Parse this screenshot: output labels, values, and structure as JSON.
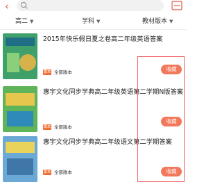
{
  "header": {
    "back_icon": "back-icon",
    "search_icon": "search-icon",
    "scan_icon": "scan-icon"
  },
  "filters": [
    {
      "label": "高二"
    },
    {
      "label": "学科"
    },
    {
      "label": "教材版本"
    }
  ],
  "results": [
    {
      "title": "2015年快乐假日夏之卷高二年级英语答案",
      "badge": "版本",
      "edition": "全部版本",
      "collect": "收藏"
    },
    {
      "title": "惠宇文化同步学典高二年级英语第二学期N版答案",
      "badge": "版本",
      "edition": "全部版本",
      "collect": "收藏"
    },
    {
      "title": "惠宇文化同步学典高二年级语文第二学期答案",
      "badge": "版本",
      "edition": "全部版本",
      "collect": "收藏"
    }
  ],
  "colors": {
    "accent": "#f1785a",
    "badge": "#f06a2e",
    "frame": "#ef5a5a"
  }
}
